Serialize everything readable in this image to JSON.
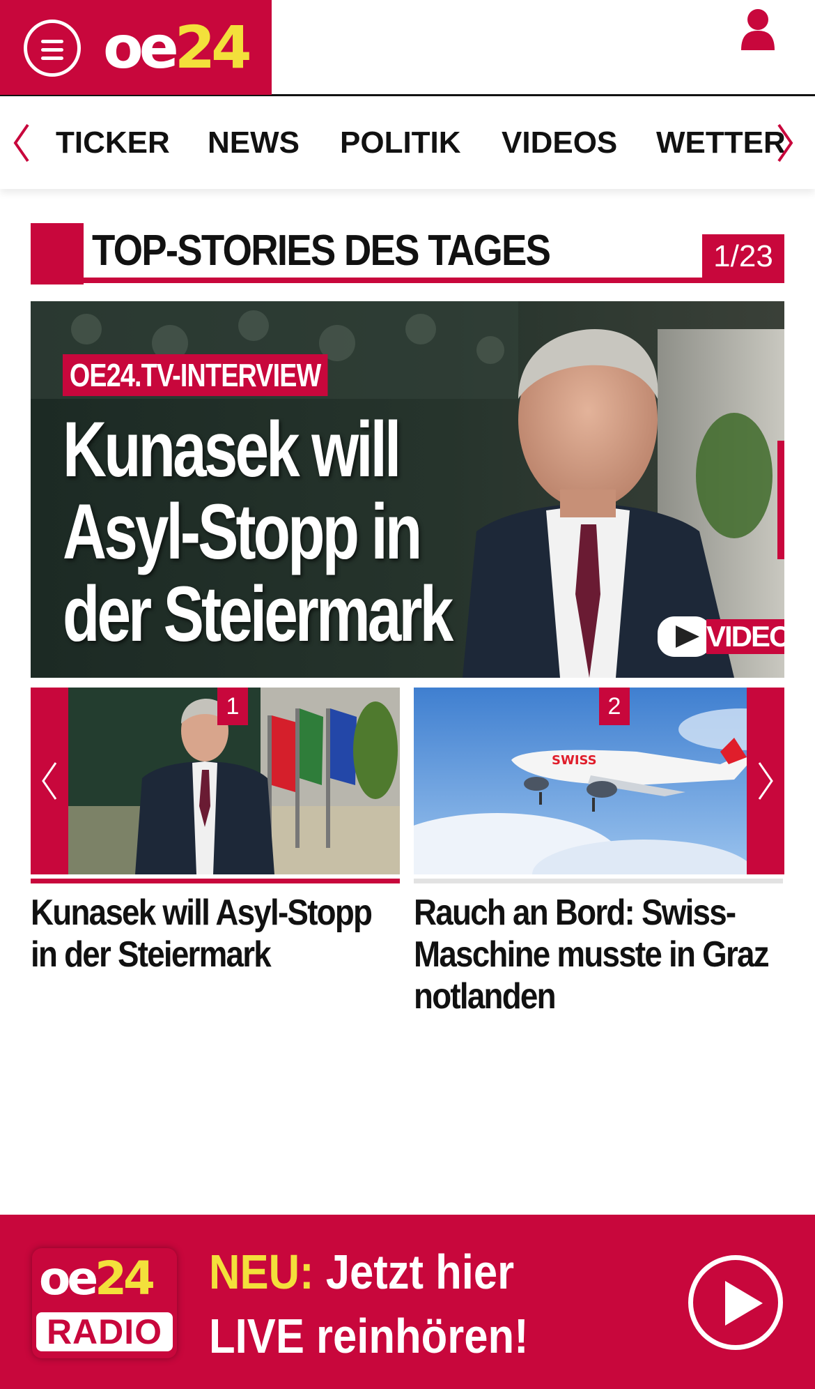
{
  "header": {
    "logo": {
      "oe": "oe",
      "num": "24"
    },
    "menu_icon": "hamburger-menu-icon",
    "user_icon": "user-icon"
  },
  "nav": {
    "items": [
      "TICKER",
      "NEWS",
      "POLITIK",
      "VIDEOS",
      "WETTER"
    ],
    "prev_icon": "chevron-left-icon",
    "next_icon": "chevron-right-icon"
  },
  "section": {
    "title": "TOP-STORIES DES TAGES",
    "counter": "1/23"
  },
  "hero": {
    "tag": "OE24.TV-INTERVIEW",
    "headline_lines": [
      "Kunasek will",
      "Asyl-Stopp in",
      "der Steiermark"
    ],
    "video_label": "VIDEO"
  },
  "teasers": [
    {
      "number": "1",
      "title": "Kunasek will Asyl-Stopp in der Steiermark"
    },
    {
      "number": "2",
      "title": "Rauch an Bord: Swiss-Maschine musste in Graz notlanden"
    }
  ],
  "radio": {
    "logo_oe": "oe",
    "logo_num": "24",
    "logo_radio": "RADIO",
    "neu": "NEU:",
    "line1_rest": " Jetzt hier",
    "line2": "LIVE reinhören!"
  },
  "colors": {
    "brand_red": "#c8073c",
    "logo_yellow": "#f3e03b"
  }
}
